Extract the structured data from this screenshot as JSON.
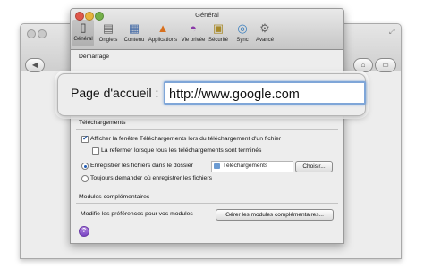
{
  "window_title": "Général",
  "toolbar": [
    {
      "label": "Général",
      "icon": "switch-icon",
      "glyph": "▯"
    },
    {
      "label": "Onglets",
      "icon": "tabs-icon",
      "glyph": "▤"
    },
    {
      "label": "Contenu",
      "icon": "content-icon",
      "glyph": "▦"
    },
    {
      "label": "Applications",
      "icon": "applications-icon",
      "glyph": "▲"
    },
    {
      "label": "Vie privée",
      "icon": "mask-icon",
      "glyph": "◓"
    },
    {
      "label": "Sécurité",
      "icon": "lock-icon",
      "glyph": "▣"
    },
    {
      "label": "Sync",
      "icon": "sync-icon",
      "glyph": "◎"
    },
    {
      "label": "Avancé",
      "icon": "gear-icon",
      "glyph": "⚙"
    }
  ],
  "startup": {
    "heading": "Démarrage"
  },
  "home_page": {
    "label": "Page d'accueil :",
    "value": "http://www.google.com"
  },
  "downloads": {
    "heading": "Téléchargements",
    "show_window": "Afficher la fenêtre Téléchargements lors du téléchargement d'un fichier",
    "close_when_done": "La refermer lorsque tous les téléchargements sont terminés",
    "save_to": "Enregistrer les fichiers dans le dossier",
    "folder": "Téléchargements",
    "choose_button": "Choisir...",
    "always_ask": "Toujours demander où enregistrer les fichiers"
  },
  "addons": {
    "heading": "Modules complémentaires",
    "description": "Modifie les préférences pour vos modules",
    "manage_button": "Gérer les modules complémentaires..."
  },
  "help_glyph": "?"
}
